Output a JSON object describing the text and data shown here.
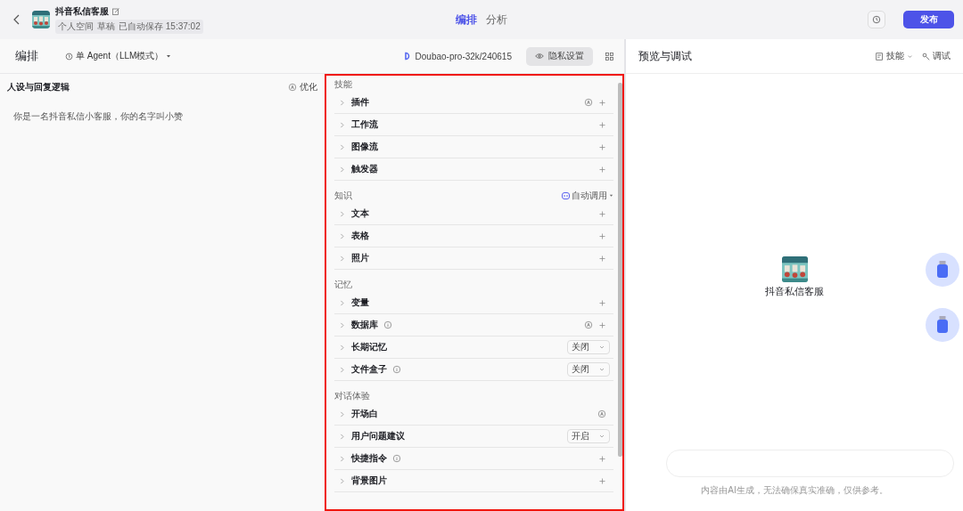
{
  "header": {
    "bot_name": "抖音私信客服",
    "space": "个人空间",
    "status": "草稿",
    "saved": "已自动保存 15:37:02",
    "tabs": [
      {
        "label": "编排",
        "selected": true
      },
      {
        "label": "分析",
        "selected": false
      }
    ],
    "publish": "发布"
  },
  "toolbar": {
    "title": "编排",
    "mode": "单 Agent（LLM模式）",
    "model": "Doubao-pro-32k/240615",
    "privacy": "隐私设置"
  },
  "prompt": {
    "title": "人设与回复逻辑",
    "optimize": "优化",
    "text": "你是一名抖音私信小客服，你的名字叫小赞"
  },
  "sections": [
    {
      "title": "技能",
      "items": [
        {
          "label": "插件",
          "kind": "add",
          "info": false,
          "auto": true
        },
        {
          "label": "工作流",
          "kind": "add",
          "info": false,
          "auto": false
        },
        {
          "label": "图像流",
          "kind": "add",
          "info": false,
          "auto": false
        },
        {
          "label": "触发器",
          "kind": "add",
          "info": false,
          "auto": false
        }
      ]
    },
    {
      "title": "知识",
      "action": "自动调用",
      "items": [
        {
          "label": "文本",
          "kind": "add",
          "info": false,
          "auto": false
        },
        {
          "label": "表格",
          "kind": "add",
          "info": false,
          "auto": false
        },
        {
          "label": "照片",
          "kind": "add",
          "info": false,
          "auto": false
        }
      ]
    },
    {
      "title": "记忆",
      "items": [
        {
          "label": "变量",
          "kind": "add",
          "info": false,
          "auto": false
        },
        {
          "label": "数据库",
          "kind": "add",
          "info": true,
          "auto": true
        },
        {
          "label": "长期记忆",
          "kind": "select",
          "info": false,
          "value": "关闭"
        },
        {
          "label": "文件盒子",
          "kind": "select",
          "info": true,
          "value": "关闭"
        }
      ]
    },
    {
      "title": "对话体验",
      "items": [
        {
          "label": "开场白",
          "kind": "auto",
          "info": false,
          "auto": true
        },
        {
          "label": "用户问题建议",
          "kind": "select",
          "info": false,
          "value": "开启"
        },
        {
          "label": "快捷指令",
          "kind": "add",
          "info": true,
          "auto": false
        },
        {
          "label": "背景图片",
          "kind": "add",
          "info": false,
          "auto": false
        }
      ]
    }
  ],
  "preview": {
    "title": "预览与调试",
    "skills": "技能",
    "debug": "调试",
    "bot_name": "抖音私信客服",
    "disclaimer": "内容由AI生成，无法确保真实准确，仅供参考。"
  }
}
